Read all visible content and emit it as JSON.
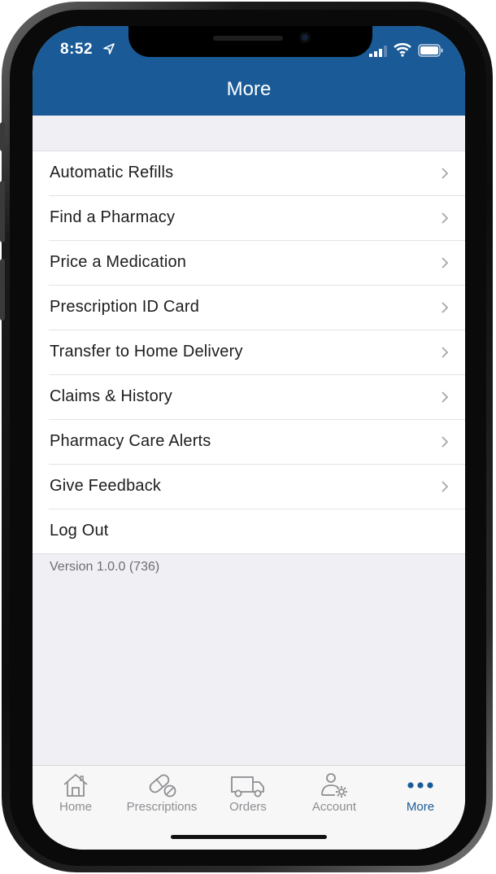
{
  "status_bar": {
    "time": "8:52"
  },
  "nav": {
    "title": "More"
  },
  "menu": {
    "items": [
      {
        "label": "Automatic Refills",
        "chevron": true
      },
      {
        "label": "Find a Pharmacy",
        "chevron": true
      },
      {
        "label": "Price a Medication",
        "chevron": true
      },
      {
        "label": "Prescription ID Card",
        "chevron": true
      },
      {
        "label": "Transfer to Home Delivery",
        "chevron": true
      },
      {
        "label": "Claims & History",
        "chevron": true
      },
      {
        "label": "Pharmacy Care Alerts",
        "chevron": true
      },
      {
        "label": "Give Feedback",
        "chevron": true
      },
      {
        "label": "Log Out",
        "chevron": false
      }
    ]
  },
  "version": "Version 1.0.0 (736)",
  "tabs": [
    {
      "label": "Home",
      "icon": "home-icon"
    },
    {
      "label": "Prescriptions",
      "icon": "pill-icon"
    },
    {
      "label": "Orders",
      "icon": "truck-icon"
    },
    {
      "label": "Account",
      "icon": "account-settings-icon"
    },
    {
      "label": "More",
      "icon": "more-dots-icon",
      "active": true
    }
  ],
  "colors": {
    "brand": "#1a5a96",
    "tab_inactive": "#8e8e93",
    "background": "#efeff4"
  }
}
